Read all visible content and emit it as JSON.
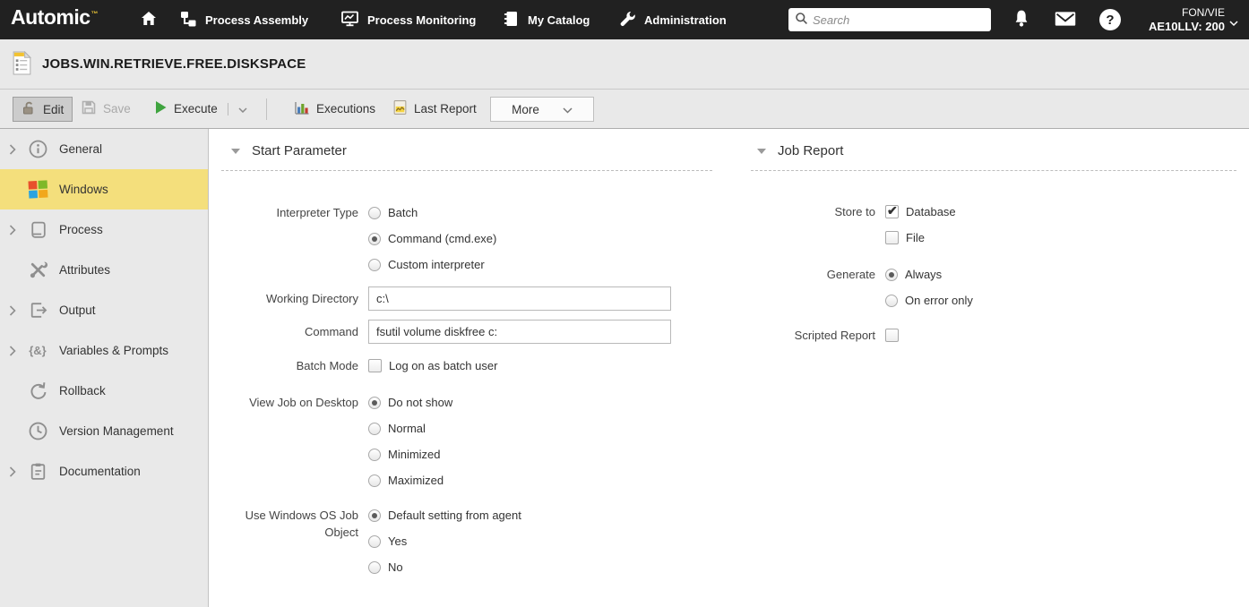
{
  "navbar": {
    "logo": "Automic",
    "trademark": "™",
    "items": [
      {
        "label": "Process Assembly"
      },
      {
        "label": "Process Monitoring"
      },
      {
        "label": "My Catalog"
      },
      {
        "label": "Administration"
      }
    ],
    "search": {
      "placeholder": "Search"
    },
    "help_glyph": "?",
    "client": {
      "line1": "FON/VIE",
      "line2": "AE10LLV: 200"
    }
  },
  "title_bar": {
    "object_name": "JOBS.WIN.RETRIEVE.FREE.DISKSPACE"
  },
  "toolbar": {
    "edit_label": "Edit",
    "save_label": "Save",
    "execute_label": "Execute",
    "executions_label": "Executions",
    "last_report_label": "Last Report",
    "more_label": "More"
  },
  "sidebar": {
    "items": [
      {
        "label": "General",
        "expandable": true,
        "selected": false
      },
      {
        "label": "Windows",
        "expandable": false,
        "selected": true
      },
      {
        "label": "Process",
        "expandable": true,
        "selected": false
      },
      {
        "label": "Attributes",
        "expandable": false,
        "selected": false
      },
      {
        "label": "Output",
        "expandable": true,
        "selected": false
      },
      {
        "label": "Variables & Prompts",
        "expandable": true,
        "selected": false
      },
      {
        "label": "Rollback",
        "expandable": false,
        "selected": false
      },
      {
        "label": "Version Management",
        "expandable": false,
        "selected": false
      },
      {
        "label": "Documentation",
        "expandable": true,
        "selected": false
      }
    ],
    "variables_icon_glyph": "{&}"
  },
  "start_parameter": {
    "heading": "Start Parameter",
    "interpreter_type": {
      "label": "Interpreter Type",
      "options": [
        "Batch",
        "Command (cmd.exe)",
        "Custom interpreter"
      ],
      "selected": "Command (cmd.exe)"
    },
    "working_directory": {
      "label": "Working Directory",
      "value": "c:\\"
    },
    "command": {
      "label": "Command",
      "value": "fsutil volume diskfree c:"
    },
    "batch_mode": {
      "label": "Batch Mode",
      "option": "Log on as batch user",
      "checked": false
    },
    "view_job_on_desktop": {
      "label": "View Job on Desktop",
      "options": [
        "Do not show",
        "Normal",
        "Minimized",
        "Maximized"
      ],
      "selected": "Do not show"
    },
    "use_windows_os_job_object": {
      "label": "Use Windows OS Job Object",
      "options": [
        "Default setting from agent",
        "Yes",
        "No"
      ],
      "selected": "Default setting from agent"
    }
  },
  "job_report": {
    "heading": "Job Report",
    "store_to": {
      "label": "Store to",
      "options": [
        {
          "label": "Database",
          "checked": true
        },
        {
          "label": "File",
          "checked": false
        }
      ]
    },
    "generate": {
      "label": "Generate",
      "options": [
        "Always",
        "On error only"
      ],
      "selected": "Always"
    },
    "scripted_report": {
      "label": "Scripted Report",
      "checked": false
    }
  },
  "colors": {
    "navbar_bg": "#212121",
    "selected_sidebar_item": "#f4df7c",
    "execute_green": "#3fa43f",
    "trademark_gold": "#e6c235",
    "panel_gray": "#e9e9e9",
    "windows_red": "#e8502c",
    "windows_green": "#7eb829",
    "windows_blue": "#2ba3e0",
    "windows_yellow": "#f1a81c"
  }
}
